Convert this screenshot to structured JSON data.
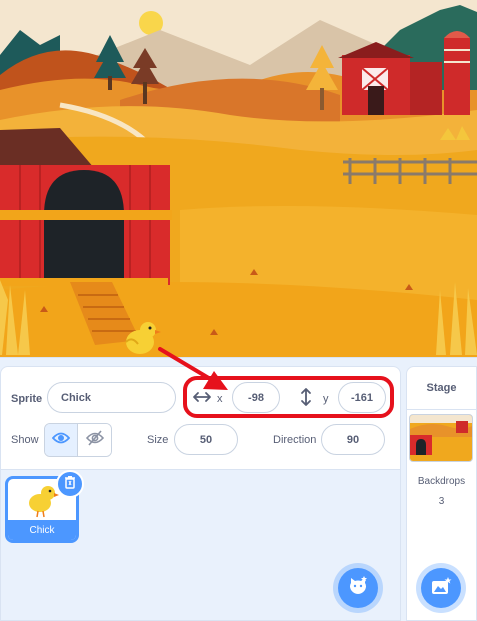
{
  "sprite_info": {
    "sprite_label": "Sprite",
    "sprite_name": "Chick",
    "x_label": "x",
    "x_value": "-98",
    "y_label": "y",
    "y_value": "-161",
    "show_label": "Show",
    "size_label": "Size",
    "size_value": "50",
    "direction_label": "Direction",
    "direction_value": "90",
    "visible": true
  },
  "sprite_list": {
    "items": [
      {
        "name": "Chick",
        "selected": true
      }
    ]
  },
  "stage_panel": {
    "title": "Stage",
    "backdrops_label": "Backdrops",
    "backdrops_count": "3"
  },
  "colors": {
    "accent": "#4c97ff",
    "highlight": "#e6111c",
    "text": "#575e75"
  },
  "icons": [
    "horizontal-arrows-icon",
    "vertical-arrows-icon",
    "eye-icon",
    "eye-slash-icon",
    "trash-icon",
    "choose-sprite-icon",
    "choose-backdrop-icon"
  ]
}
